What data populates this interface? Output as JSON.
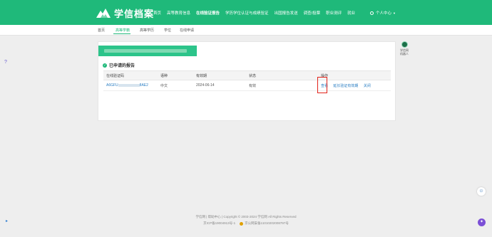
{
  "logo": {
    "text": "学信档案"
  },
  "nav": {
    "items": [
      "首页",
      "高等教育信息",
      "在线验证报告",
      "学历学位认证与成绩验证",
      "出国报告发送",
      "调查/投票",
      "职业测评",
      "就业"
    ],
    "active_index": 2,
    "user": "个人中心"
  },
  "subnav": {
    "items": [
      "首页",
      "高等学籍",
      "高等学历",
      "学位",
      "在线申请"
    ],
    "active_index": 1
  },
  "card": {
    "section_title": "已申请的报告",
    "table": {
      "headers": [
        "在线验证码",
        "语种",
        "有效期",
        "状态",
        "操作"
      ],
      "rows": [
        {
          "code_prefix": "A6GFU",
          "code_suffix": "8AE2",
          "language": "中文",
          "expiry": "2024-06-14",
          "status": "有效",
          "actions": [
            "查看",
            "延长验证有效期",
            "关闭"
          ]
        }
      ]
    }
  },
  "side_widget": {
    "label": "学信网\n机器人"
  },
  "footer": {
    "line1": "学信网  |  帮助中心  |  Copyright © 2003-2024 学信网 All Rights Reserved",
    "icp": "京ICP备19004913号-1",
    "police": "京公网安备11010202008797号"
  },
  "colors": {
    "brand": "#1fb97a",
    "link": "#2a7ec3",
    "highlight": "#e2231a"
  }
}
